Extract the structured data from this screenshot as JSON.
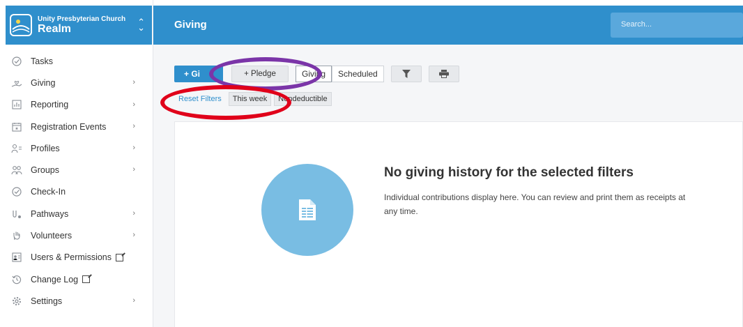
{
  "brand": {
    "org_name": "Unity Presbyterian Church",
    "product": "Realm"
  },
  "sidebar": {
    "items": [
      {
        "label": "Tasks",
        "icon": "check-circle-icon",
        "has_arrow": false
      },
      {
        "label": "Giving",
        "icon": "hand-heart-icon",
        "has_arrow": true
      },
      {
        "label": "Reporting",
        "icon": "bar-chart-icon",
        "has_arrow": true
      },
      {
        "label": "Registration Events",
        "icon": "calendar-star-icon",
        "has_arrow": true
      },
      {
        "label": "Profiles",
        "icon": "person-list-icon",
        "has_arrow": true
      },
      {
        "label": "Groups",
        "icon": "people-icon",
        "has_arrow": true
      },
      {
        "label": "Check-In",
        "icon": "check-circle-icon",
        "has_arrow": false
      },
      {
        "label": "Pathways",
        "icon": "pathways-icon",
        "has_arrow": true
      },
      {
        "label": "Volunteers",
        "icon": "hand-icon",
        "has_arrow": true
      },
      {
        "label": "Users & Permissions",
        "icon": "id-card-icon",
        "has_arrow": false,
        "external": true
      },
      {
        "label": "Change Log",
        "icon": "history-icon",
        "has_arrow": false,
        "external": true
      },
      {
        "label": "Settings",
        "icon": "gear-icon",
        "has_arrow": true
      }
    ]
  },
  "header": {
    "title": "Giving",
    "search_placeholder": "Search..."
  },
  "toolbar": {
    "give_label": "+ Gi",
    "pledge_label": "+ Pledge",
    "tabs": [
      "Giving",
      "Scheduled"
    ]
  },
  "filters": {
    "reset_label": "Reset Filters",
    "chips": [
      "This week",
      "Nondeductible"
    ]
  },
  "empty_state": {
    "title": "No giving history for the selected filters",
    "description": "Individual contributions display here. You can review and print them as receipts at any time."
  },
  "colors": {
    "brand_blue": "#2f8fcc",
    "illustration_blue": "#79bde3",
    "annotation_purple": "#7b35a8",
    "annotation_red": "#e0001a"
  }
}
